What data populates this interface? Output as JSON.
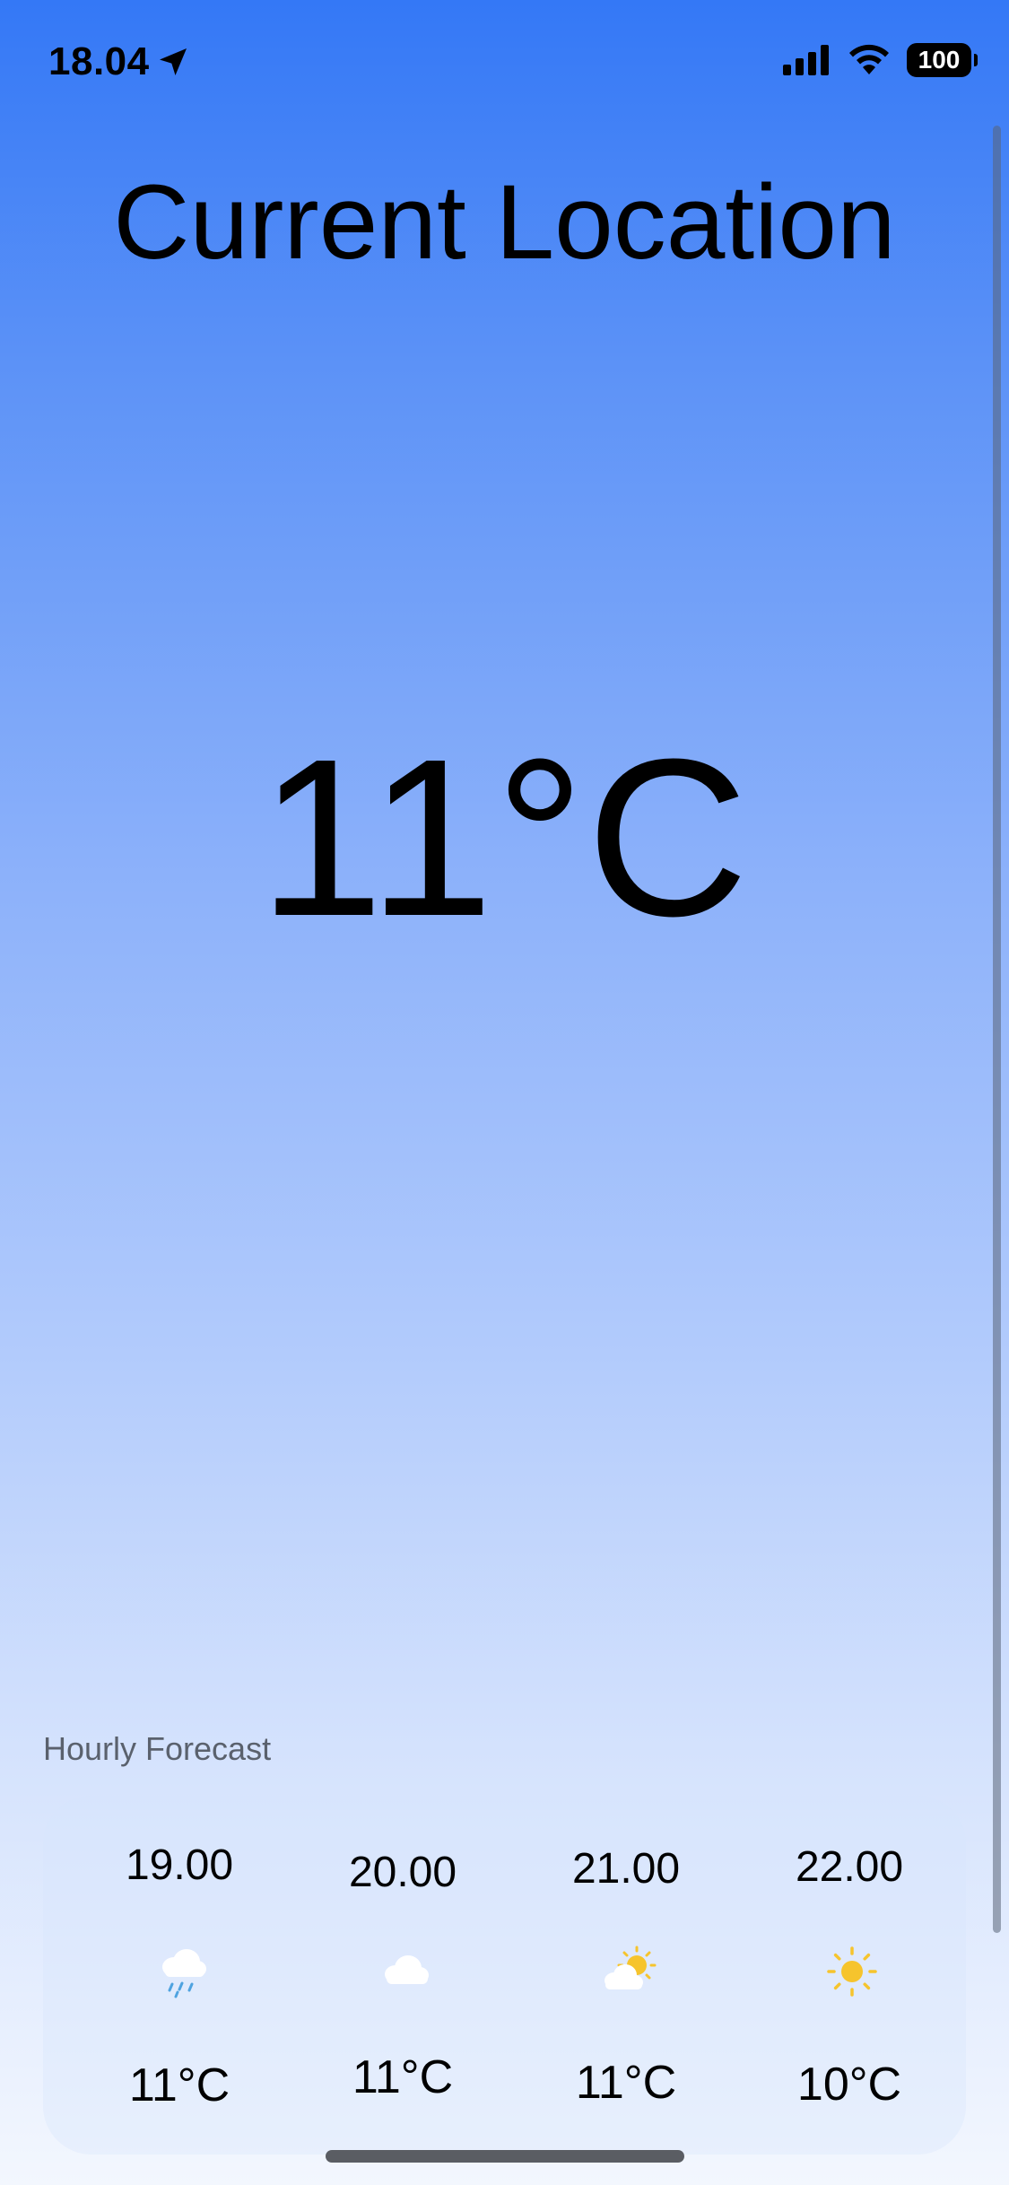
{
  "status_bar": {
    "time": "18.04",
    "battery": "100",
    "icons": [
      "location-arrow-icon",
      "cellular-signal-icon",
      "wifi-icon",
      "battery-icon"
    ]
  },
  "location": {
    "title": "Current Location"
  },
  "current": {
    "temperature": "11°C"
  },
  "hourly": {
    "label": "Hourly Forecast",
    "items": [
      {
        "time": "19.00",
        "icon": "cloud-rain-icon",
        "temp": "11°C"
      },
      {
        "time": "20.00",
        "icon": "cloud-icon",
        "temp": "11°C"
      },
      {
        "time": "21.00",
        "icon": "partly-cloudy-icon",
        "temp": "11°C"
      },
      {
        "time": "22.00",
        "icon": "sun-icon",
        "temp": "10°C"
      }
    ]
  },
  "colors": {
    "gradient_top": "#3478f6",
    "gradient_bottom": "#f3f7fe",
    "sun": "#f6c42d",
    "rain": "#4fa3e0",
    "cloud": "#ffffff"
  }
}
